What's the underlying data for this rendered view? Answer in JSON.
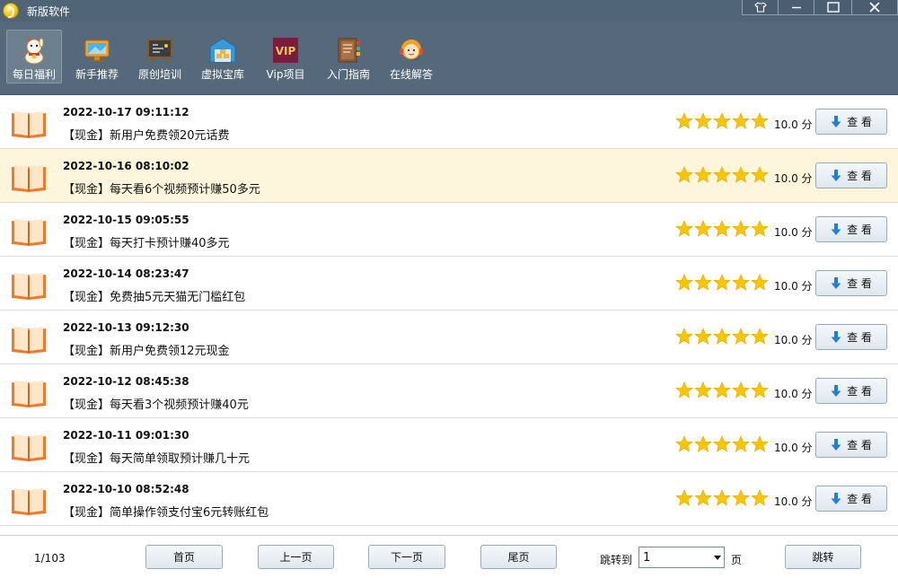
{
  "window": {
    "title": "新版软件"
  },
  "toolbar": {
    "items": [
      {
        "label": "每日福利",
        "icon": "lucky-cat-icon",
        "active": true
      },
      {
        "label": "新手推荐",
        "icon": "monitor-icon",
        "active": false
      },
      {
        "label": "原创培训",
        "icon": "blackboard-icon",
        "active": false
      },
      {
        "label": "虚拟宝库",
        "icon": "warehouse-icon",
        "active": false
      },
      {
        "label": "Vip项目",
        "icon": "vip-icon",
        "active": false
      },
      {
        "label": "入门指南",
        "icon": "guide-book-icon",
        "active": false
      },
      {
        "label": "在线解答",
        "icon": "support-agent-icon",
        "active": false
      }
    ]
  },
  "list": {
    "rows": [
      {
        "date": "2022-10-17 09:11:12",
        "title": "【现金】新用户免费领20元话费",
        "rating": 5,
        "score": "10.0 分",
        "button": "查 看",
        "highlighted": false
      },
      {
        "date": "2022-10-16 08:10:02",
        "title": "【现金】每天看6个视频预计赚50多元",
        "rating": 5,
        "score": "10.0 分",
        "button": "查 看",
        "highlighted": true
      },
      {
        "date": "2022-10-15 09:05:55",
        "title": "【现金】每天打卡预计赚40多元",
        "rating": 5,
        "score": "10.0 分",
        "button": "查 看",
        "highlighted": false
      },
      {
        "date": "2022-10-14 08:23:47",
        "title": "【现金】免费抽5元天猫无门槛红包",
        "rating": 5,
        "score": "10.0 分",
        "button": "查 看",
        "highlighted": false
      },
      {
        "date": "2022-10-13 09:12:30",
        "title": "【现金】新用户免费领12元现金",
        "rating": 5,
        "score": "10.0 分",
        "button": "查 看",
        "highlighted": false
      },
      {
        "date": "2022-10-12 08:45:38",
        "title": "【现金】每天看3个视频预计赚40元",
        "rating": 5,
        "score": "10.0 分",
        "button": "查 看",
        "highlighted": false
      },
      {
        "date": "2022-10-11 09:01:30",
        "title": "【现金】每天简单领取预计赚几十元",
        "rating": 5,
        "score": "10.0 分",
        "button": "查 看",
        "highlighted": false
      },
      {
        "date": "2022-10-10 08:52:48",
        "title": "【现金】简单操作领支付宝6元转账红包",
        "rating": 5,
        "score": "10.0 分",
        "button": "查 看",
        "highlighted": false
      }
    ]
  },
  "footer": {
    "page_info": "1/103",
    "first": "首页",
    "prev": "上一页",
    "next": "下一页",
    "last": "尾页",
    "jump_label": "跳转到",
    "jump_value": "1",
    "page_unit": "页",
    "jump_button": "跳转"
  },
  "colors": {
    "titlebar": "#4f6475",
    "toolbar": "#56697a",
    "highlight_row": "#fdf5dc",
    "star": "#f7c600",
    "book": "#f07a2a"
  }
}
